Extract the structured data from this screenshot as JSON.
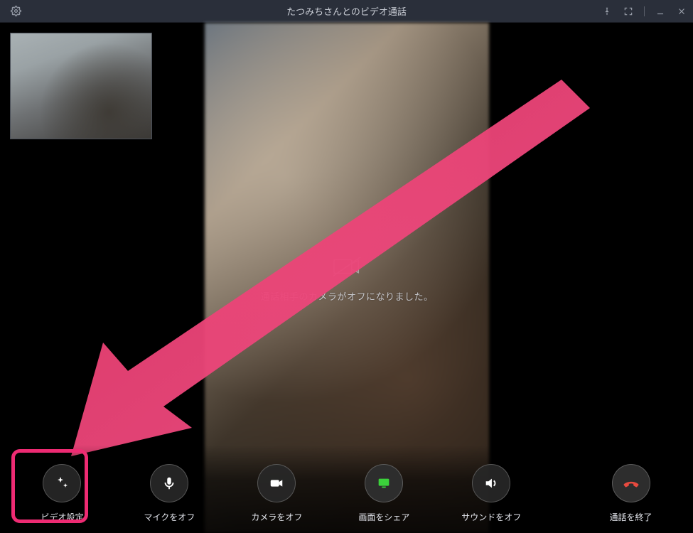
{
  "titlebar": {
    "title": "たつみちさんとのビデオ通話"
  },
  "remote": {
    "camera_off_message": "通話相手のカメラがオフになりました。"
  },
  "toolbar": {
    "video_settings": "ビデオ設定",
    "mic_off": "マイクをオフ",
    "camera_off": "カメラをオフ",
    "share_screen": "画面をシェア",
    "sound_off": "サウンドをオフ",
    "end_call": "通話を終了"
  },
  "colors": {
    "highlight": "#ee2b73",
    "share_icon": "#3bd23b",
    "end_icon": "#e84a3f"
  }
}
